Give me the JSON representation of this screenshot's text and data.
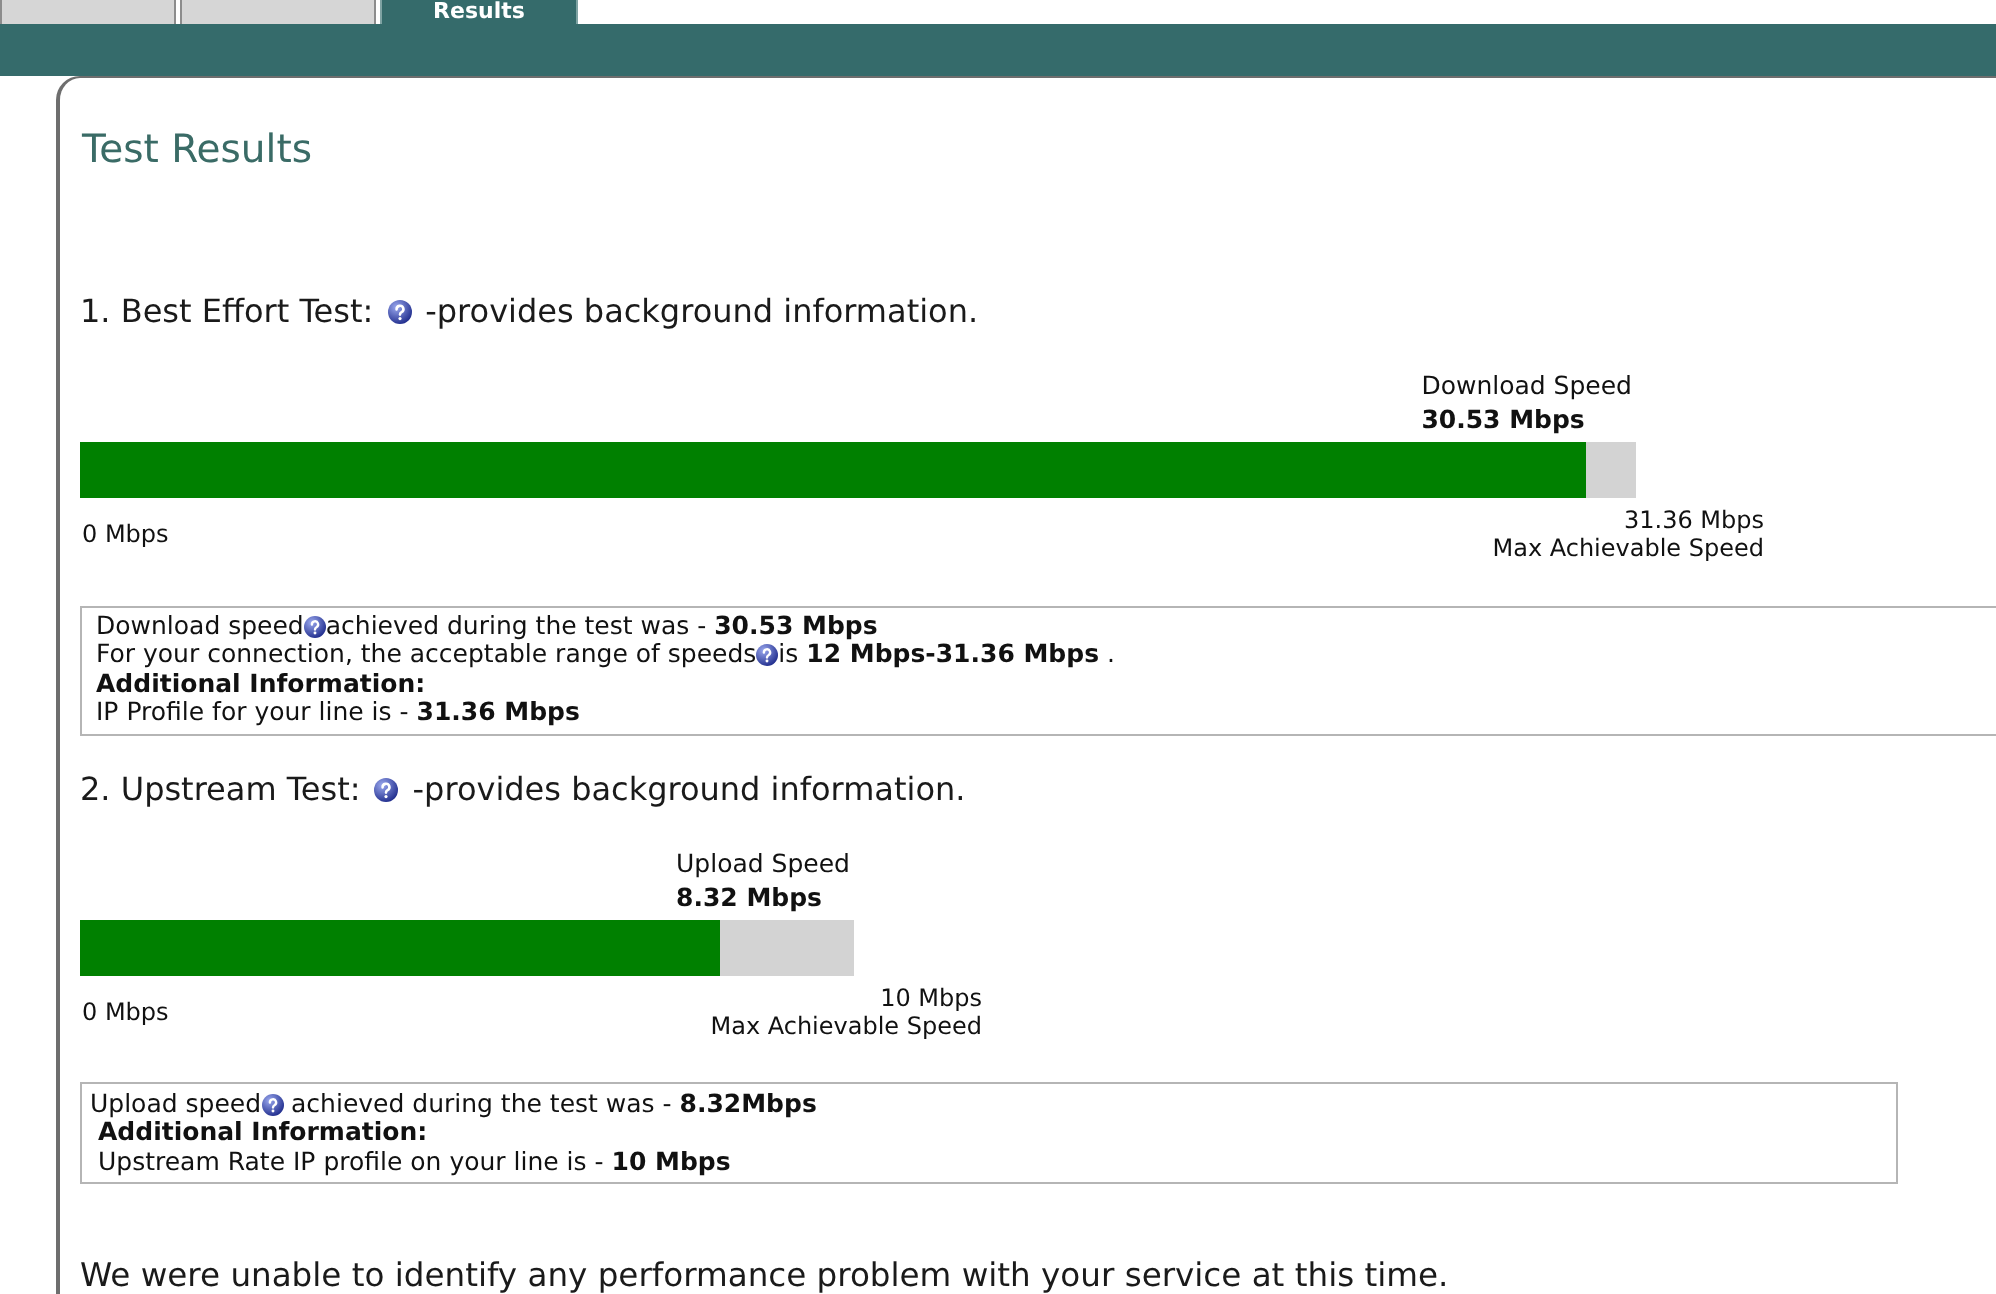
{
  "tabs": [
    {
      "selected": false
    },
    {
      "selected": false
    },
    {
      "label": "Results",
      "selected": true
    }
  ],
  "panel": {
    "title": "Test Results"
  },
  "sections": [
    {
      "heading": "1. Best Effort Test:",
      "help_icon": true,
      "note": "-provides background information.",
      "meter": {
        "label": "Download Speed",
        "value": "30.53 Mbps",
        "level": 0.968,
        "min_label": "0 Mbps",
        "max_value": "31.36 Mbps",
        "max_label": "Max Achievable Speed"
      },
      "info": [
        {
          "text": "Download speed",
          "help_icon": true,
          "after": "achieved during the test was - **30.53 Mbps**",
          "bold": false
        },
        {
          "text": "For your connection, the acceptable range of speeds",
          "help_icon": true,
          "after": "is **12 Mbps-31.36 Mbps** .",
          "bold": false
        },
        {
          "text": "Additional Information:",
          "help_icon": false,
          "bold": true
        },
        {
          "text": "IP Profile for your line is - **31.36 Mbps**",
          "help_icon": false,
          "bold": false
        }
      ]
    },
    {
      "heading": "2. Upstream Test:",
      "help_icon": true,
      "note": "-provides background information.",
      "meter": {
        "label": "Upload Speed",
        "value": "8.32 Mbps",
        "level": 0.827,
        "min_label": "0 Mbps",
        "max_value": "10 Mbps",
        "max_label": "Max Achievable Speed"
      },
      "info": [
        {
          "text": "Upload speed",
          "help_icon": true,
          "after": " achieved during the test was - **8.32Mbps**",
          "bold": false
        },
        {
          "text": "Additional Information:",
          "help_icon": false,
          "bold": true
        },
        {
          "text": "Upstream Rate IP profile on your line is - **10 Mbps**",
          "help_icon": false,
          "bold": false
        }
      ]
    }
  ],
  "summary": "We were unable to identify any performance problem with your service at this time."
}
